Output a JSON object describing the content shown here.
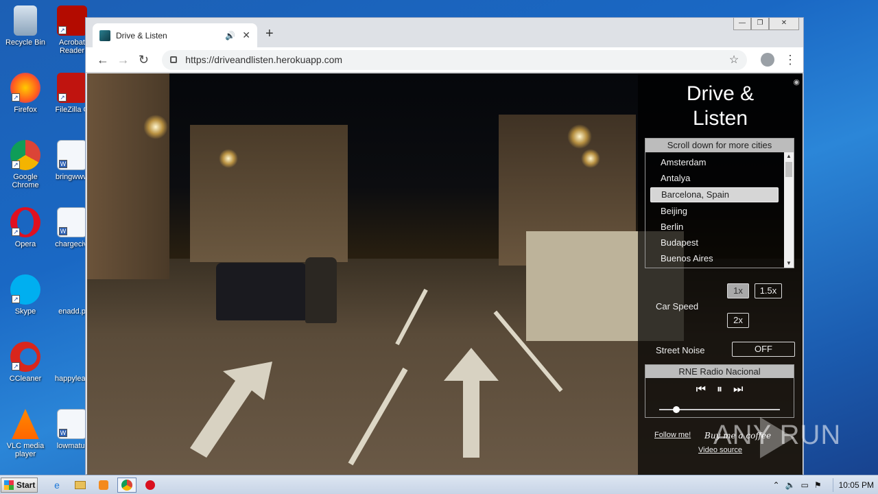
{
  "desktop": {
    "icons": [
      {
        "label": "Recycle Bin",
        "icon": "recycle-bin-icon"
      },
      {
        "label": "Acrobat Reader",
        "icon": "acrobat-icon"
      },
      {
        "label": "Firefox",
        "icon": "firefox-icon"
      },
      {
        "label": "FileZilla C",
        "icon": "filezilla-icon"
      },
      {
        "label": "Google Chrome",
        "icon": "chrome-icon"
      },
      {
        "label": "bringwww",
        "icon": "word-doc-icon"
      },
      {
        "label": "Opera",
        "icon": "opera-icon"
      },
      {
        "label": "chargecivi",
        "icon": "word-doc-icon"
      },
      {
        "label": "Skype",
        "icon": "skype-icon"
      },
      {
        "label": "enadd.p",
        "icon": "file-icon"
      },
      {
        "label": "CCleaner",
        "icon": "ccleaner-icon"
      },
      {
        "label": "happyleav",
        "icon": "file-icon"
      },
      {
        "label": "VLC media player",
        "icon": "vlc-icon"
      },
      {
        "label": "lowmatur",
        "icon": "word-doc-icon"
      }
    ]
  },
  "browser": {
    "tab_title": "Drive & Listen",
    "sound_icon": "🔊",
    "close_glyph": "✕",
    "new_tab_glyph": "+",
    "url": "https://driveandlisten.herokuapp.com",
    "window_controls": {
      "minimize": "—",
      "restore": "❐",
      "close": "✕"
    },
    "nav": {
      "back": "←",
      "forward": "→",
      "reload": "↻",
      "star": "☆",
      "menu": "⋮"
    }
  },
  "app": {
    "title": "Drive & Listen",
    "city_header": "Scroll down for more cities",
    "cities": [
      "Amsterdam",
      "Antalya",
      "Barcelona, Spain",
      "Beijing",
      "Berlin",
      "Budapest",
      "Buenos Aires"
    ],
    "selected_city": "Barcelona, Spain",
    "car_speed_label": "Car Speed",
    "speed_options": [
      "1x",
      "1.5x",
      "2x"
    ],
    "selected_speed": "1x",
    "street_noise_label": "Street Noise",
    "street_noise_value": "OFF",
    "radio_station": "RNE Radio Nacional",
    "radio_controls": {
      "prev": "⏮",
      "pause": "⏸",
      "next": "⏭"
    },
    "volume_level": 0.14,
    "follow_link": "Follow me!",
    "coffee_link": "Buy me a coffee",
    "video_source_link": "Video source"
  },
  "watermark": "ANY RUN",
  "taskbar": {
    "start_label": "Start",
    "clock": "10:05 PM"
  },
  "colors": {
    "desktop_bg": "#1a68c4",
    "panel_bg": "#000000",
    "selected_item": "#d6d6d6"
  }
}
